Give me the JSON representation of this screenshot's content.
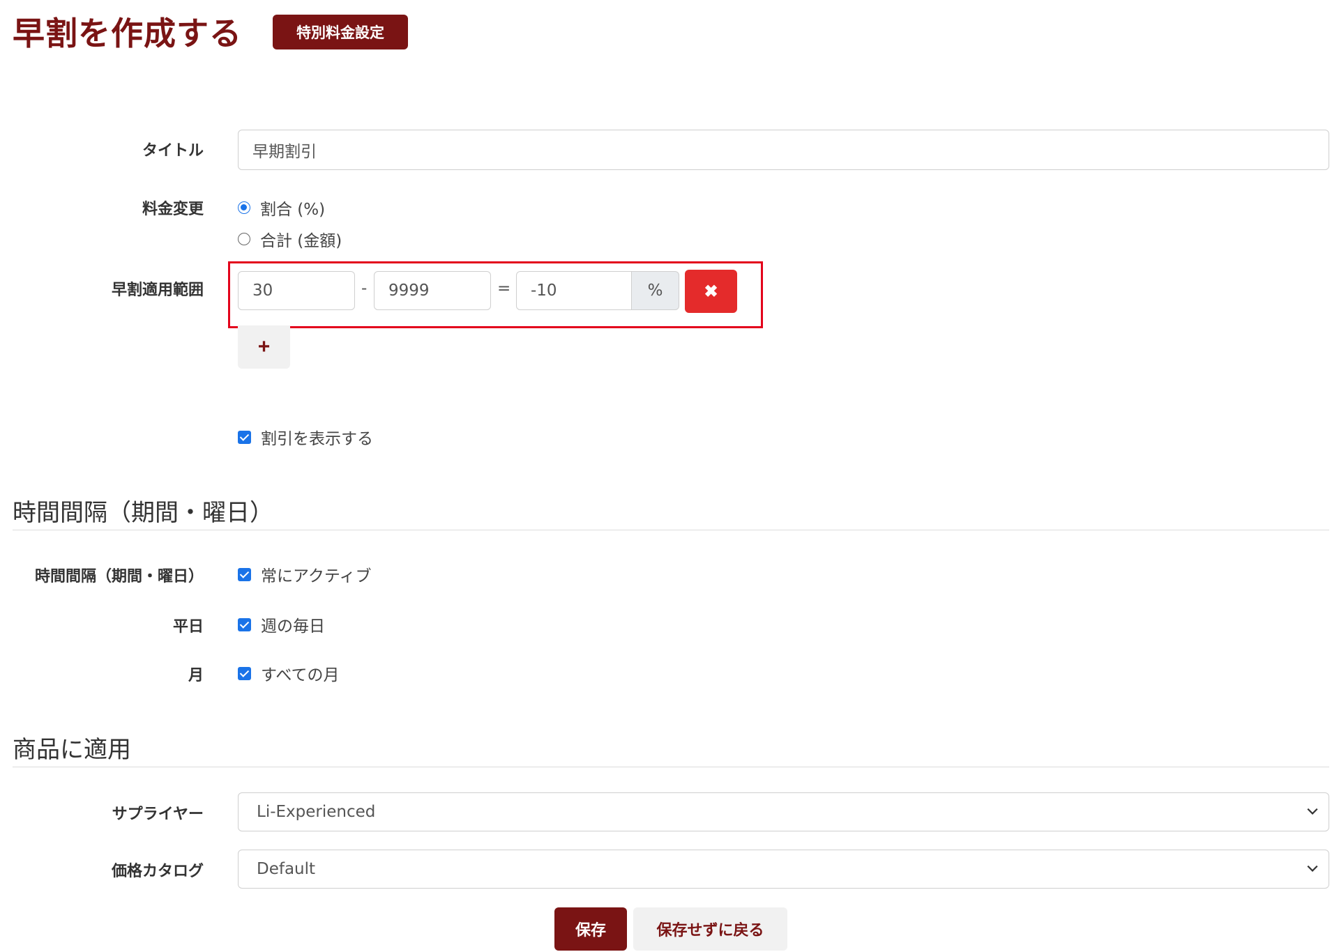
{
  "header": {
    "title": "早割を作成する",
    "badge_label": "特別料金設定"
  },
  "form": {
    "title": {
      "label": "タイトル",
      "value": "早期割引"
    },
    "price_change": {
      "label": "料金変更",
      "options": [
        {
          "label": "割合 (%)",
          "checked": true
        },
        {
          "label": "合計 (金額)",
          "checked": false
        }
      ]
    },
    "range": {
      "label": "早割適用範囲",
      "from": "30",
      "dash": "-",
      "to": "9999",
      "equals": "=",
      "value": "-10",
      "unit": "%",
      "remove_icon": "✖",
      "add_icon": "+"
    },
    "show_discount": {
      "label": "割引を表示する",
      "checked": true
    }
  },
  "section_time": {
    "title": "時間間隔（期間・曜日）",
    "rows": [
      {
        "label": "時間間隔（期間・曜日）",
        "check_label": "常にアクティブ",
        "checked": true
      },
      {
        "label": "平日",
        "check_label": "週の毎日",
        "checked": true
      },
      {
        "label": "月",
        "check_label": "すべての月",
        "checked": true
      }
    ]
  },
  "section_product": {
    "title": "商品に適用",
    "supplier": {
      "label": "サプライヤー",
      "value": "Li-Experienced"
    },
    "catalog": {
      "label": "価格カタログ",
      "value": "Default"
    }
  },
  "actions": {
    "save_label": "保存",
    "back_label": "保存せずに戻る"
  },
  "colors": {
    "brand": "#7a1414",
    "accent": "#1a73e8",
    "danger": "#e42b2b",
    "highlight": "#e3001b"
  }
}
